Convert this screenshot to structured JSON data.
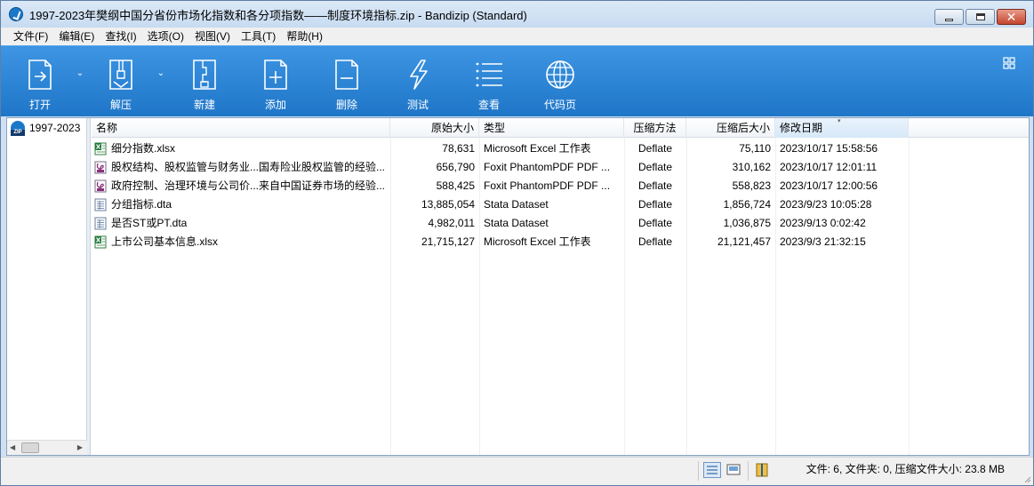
{
  "window": {
    "title": "1997-2023年樊纲中国分省份市场化指数和各分项指数——制度环境指标.zip - Bandizip (Standard)"
  },
  "menu": [
    {
      "label": "文件(F)",
      "name": "menu-file"
    },
    {
      "label": "编辑(E)",
      "name": "menu-edit"
    },
    {
      "label": "查找(I)",
      "name": "menu-find"
    },
    {
      "label": "选项(O)",
      "name": "menu-options"
    },
    {
      "label": "视图(V)",
      "name": "menu-view"
    },
    {
      "label": "工具(T)",
      "name": "menu-tools"
    },
    {
      "label": "帮助(H)",
      "name": "menu-help"
    }
  ],
  "toolbar": {
    "open": "打开",
    "extract": "解压",
    "new": "新建",
    "add": "添加",
    "delete": "删除",
    "test": "测试",
    "view": "查看",
    "codepage": "代码页"
  },
  "tree": {
    "root": "1997-2023"
  },
  "columns": {
    "name": "名称",
    "original_size": "原始大小",
    "type": "类型",
    "method": "压缩方法",
    "compressed_size": "压缩后大小",
    "modified": "修改日期"
  },
  "files": [
    {
      "name": "细分指数.xlsx",
      "original_size": "78,631",
      "type": "Microsoft Excel 工作表",
      "method": "Deflate",
      "compressed_size": "75,110",
      "modified": "2023/10/17 15:58:56",
      "icon": "excel-icon"
    },
    {
      "name": "股权结构、股权监管与财务业...国寿险业股权监管的经验...",
      "original_size": "656,790",
      "type": "Foxit PhantomPDF PDF ...",
      "method": "Deflate",
      "compressed_size": "310,162",
      "modified": "2023/10/17 12:01:11",
      "icon": "pdf-icon"
    },
    {
      "name": "政府控制、治理环境与公司价...来自中国证券市场的经验...",
      "original_size": "588,425",
      "type": "Foxit PhantomPDF PDF ...",
      "method": "Deflate",
      "compressed_size": "558,823",
      "modified": "2023/10/17 12:00:56",
      "icon": "pdf-icon"
    },
    {
      "name": "分组指标.dta",
      "original_size": "13,885,054",
      "type": "Stata Dataset",
      "method": "Deflate",
      "compressed_size": "1,856,724",
      "modified": "2023/9/23 10:05:28",
      "icon": "stata-icon"
    },
    {
      "name": "是否ST或PT.dta",
      "original_size": "4,982,011",
      "type": "Stata Dataset",
      "method": "Deflate",
      "compressed_size": "1,036,875",
      "modified": "2023/9/13 0:02:42",
      "icon": "stata-icon"
    },
    {
      "name": "上市公司基本信息.xlsx",
      "original_size": "21,715,127",
      "type": "Microsoft Excel 工作表",
      "method": "Deflate",
      "compressed_size": "21,121,457",
      "modified": "2023/9/3 21:32:15",
      "icon": "excel-icon"
    }
  ],
  "status": {
    "summary": "文件: 6, 文件夹: 0, 压缩文件大小: 23.8 MB"
  },
  "colors": {
    "toolbar_top": "#3d95e3",
    "toolbar_bottom": "#1f76c8",
    "excel_green": "#1f7a3a",
    "pdf_purple": "#8a2f7a"
  }
}
